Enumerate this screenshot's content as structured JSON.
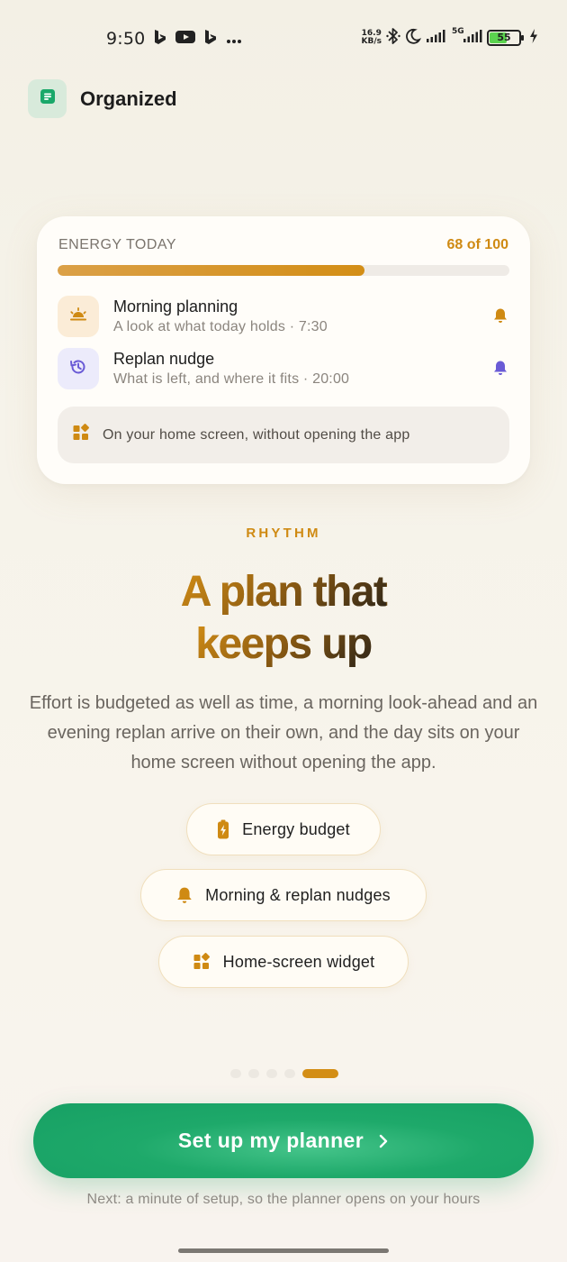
{
  "status_bar": {
    "time": "9:50",
    "net_speed_value": "16.9",
    "net_speed_unit": "KB/s",
    "network": "5G",
    "battery": "55",
    "icons": [
      "bing-icon",
      "youtube-icon",
      "bing-icon",
      "more-dots-icon",
      "bluetooth-icon",
      "moon-icon",
      "signal-icon",
      "signal-5g-icon",
      "battery-icon",
      "charging-bolt-icon"
    ]
  },
  "header": {
    "app_name": "Organized",
    "logo_icon": "notes-icon",
    "logo_color": "#1aa86a"
  },
  "card": {
    "energy_label": "ENERGY TODAY",
    "energy_count": "68 of 100",
    "energy_value": 68,
    "energy_max": 100,
    "reminders": [
      {
        "title": "Morning planning",
        "subtitle": "A look at what today holds · 7:30",
        "icon": "sunrise-icon",
        "accent": "#cf8a13"
      },
      {
        "title": "Replan nudge",
        "subtitle": "What is left, and where it fits · 20:00",
        "icon": "history-clock-icon",
        "accent": "#6a5bd6"
      }
    ],
    "widget_strip": "On your home screen, without opening the app"
  },
  "content": {
    "eyebrow": "RHYTHM",
    "headline_line1": "A plan that",
    "headline_line2": "keeps up",
    "body": "Effort is budgeted as well as time, a morning look-ahead and an evening replan arrive on their own, and the day sits on your home screen without opening the app."
  },
  "chips": [
    {
      "label": "Energy budget",
      "icon": "battery-charging-icon"
    },
    {
      "label": "Morning & replan nudges",
      "icon": "bell-icon"
    },
    {
      "label": "Home-screen widget",
      "icon": "widgets-icon"
    }
  ],
  "pager": {
    "total": 5,
    "active_index": 4
  },
  "cta": {
    "label": "Set up my planner",
    "icon": "chevron-right-icon"
  },
  "footnote": "Next: a minute of setup, so the planner opens on your hours",
  "colors": {
    "accent_amber": "#cf8a13",
    "accent_green": "#1ea96a",
    "accent_violet": "#6a5bd6"
  }
}
